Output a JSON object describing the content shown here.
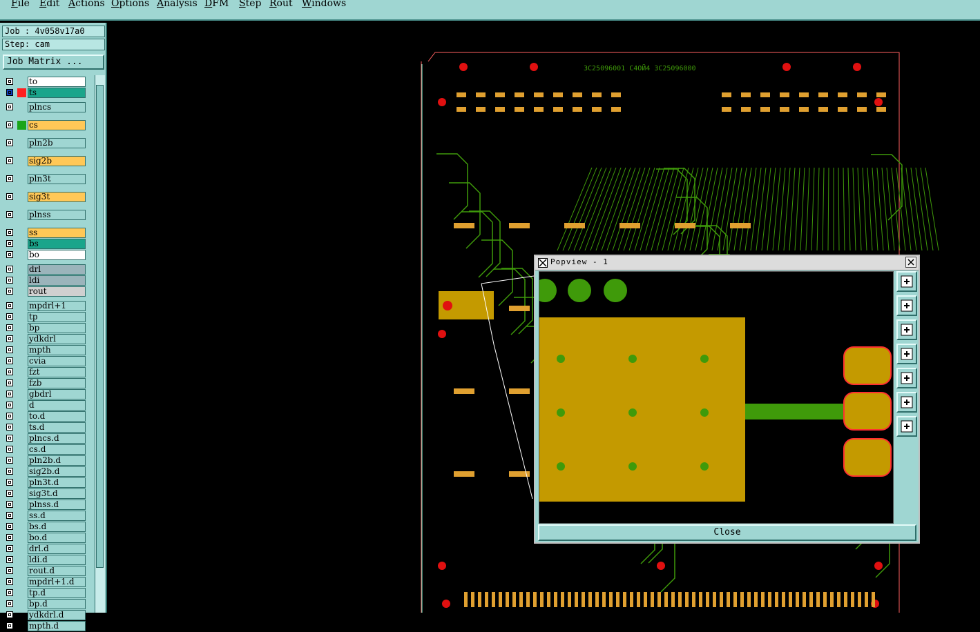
{
  "menu": [
    "File",
    "Edit",
    "Actions",
    "Options",
    "Analysis",
    "DFM",
    "Step",
    "Rout",
    "Windows"
  ],
  "job_label": "Job : 4v058v17a0",
  "step_label": "Step: cam",
  "job_matrix": "Job Matrix ...",
  "layers": [
    {
      "name": "to",
      "color": "#ffffff"
    },
    {
      "name": "ts",
      "color": "#1aa58b"
    },
    {
      "name": "plncs",
      "color": ""
    },
    {
      "name": "cs",
      "color": "#ffc857"
    },
    {
      "name": "pln2b",
      "color": ""
    },
    {
      "name": "sig2b",
      "color": "#ffc857"
    },
    {
      "name": "pln3t",
      "color": ""
    },
    {
      "name": "sig3t",
      "color": "#ffc857"
    },
    {
      "name": "plnss",
      "color": ""
    },
    {
      "name": "ss",
      "color": "#ffc857"
    },
    {
      "name": "bs",
      "color": "#1aa58b"
    },
    {
      "name": "bo",
      "color": "#ffffff"
    },
    {
      "name": "drl",
      "color": "#9bb4bb"
    },
    {
      "name": "ldi",
      "color": "#9bb4bb"
    },
    {
      "name": "rout",
      "color": "#d0d0d0"
    },
    {
      "name": "mpdrl+1",
      "color": ""
    },
    {
      "name": "tp",
      "color": ""
    },
    {
      "name": "bp",
      "color": ""
    },
    {
      "name": "ydkdrl",
      "color": ""
    },
    {
      "name": "mpth",
      "color": ""
    },
    {
      "name": "cvia",
      "color": ""
    },
    {
      "name": "fzt",
      "color": ""
    },
    {
      "name": "fzb",
      "color": ""
    },
    {
      "name": "gbdrl",
      "color": ""
    },
    {
      "name": "d",
      "color": ""
    },
    {
      "name": "to.d",
      "color": ""
    },
    {
      "name": "ts.d",
      "color": ""
    },
    {
      "name": "plncs.d",
      "color": ""
    },
    {
      "name": "cs.d",
      "color": ""
    },
    {
      "name": "pln2b.d",
      "color": ""
    },
    {
      "name": "sig2b.d",
      "color": ""
    },
    {
      "name": "pln3t.d",
      "color": ""
    },
    {
      "name": "sig3t.d",
      "color": ""
    },
    {
      "name": "plnss.d",
      "color": ""
    },
    {
      "name": "ss.d",
      "color": ""
    },
    {
      "name": "bs.d",
      "color": ""
    },
    {
      "name": "bo.d",
      "color": ""
    },
    {
      "name": "drl.d",
      "color": ""
    },
    {
      "name": "ldi.d",
      "color": ""
    },
    {
      "name": "rout.d",
      "color": ""
    },
    {
      "name": "mpdrl+1.d",
      "color": ""
    },
    {
      "name": "tp.d",
      "color": ""
    },
    {
      "name": "bp.d",
      "color": ""
    },
    {
      "name": "ydkdrl.d",
      "color": ""
    },
    {
      "name": "mpth.d",
      "color": ""
    }
  ],
  "pcb_text": "3C25096001   C4OЙ4   3C25096000",
  "popup": {
    "title": "Popview - 1",
    "close_label": "Close"
  },
  "colors": {
    "copper": "#c49a00",
    "pad": "#e0a030",
    "trace": "#3f9a0a",
    "hole": "#e01010",
    "outline": "#ff6060"
  }
}
